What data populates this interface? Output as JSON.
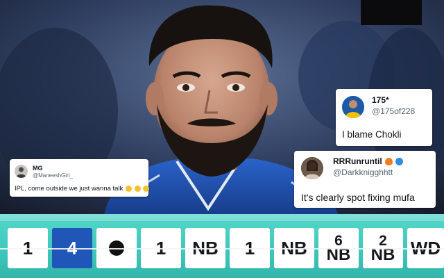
{
  "tweets": [
    {
      "name": "MG",
      "handle": "@ManeeshGiri_",
      "text": "IPL, come outside we just wanna talk",
      "emoji": [
        "loudly-crying-face-icon",
        "loudly-crying-face-icon",
        "loudly-crying-face-icon"
      ]
    },
    {
      "name": "175*",
      "handle": "@175of228",
      "text": "I blame Chokli"
    },
    {
      "name": "RRRunruntil",
      "name_emoji": [
        "fire-icon",
        "wave-icon"
      ],
      "handle": "@Darkknigghhtt",
      "text": "It's clearly spot fixing mufa"
    }
  ],
  "over_balls": [
    {
      "top": "1",
      "bottom": ""
    },
    {
      "top": "4",
      "bottom": "",
      "highlight": true
    },
    {
      "top": "",
      "bottom": "",
      "wicket": true
    },
    {
      "top": "1",
      "bottom": ""
    },
    {
      "top": "NB",
      "bottom": ""
    },
    {
      "top": "1",
      "bottom": ""
    },
    {
      "top": "NB",
      "bottom": ""
    },
    {
      "top": "6",
      "bottom": "NB"
    },
    {
      "top": "2",
      "bottom": "NB"
    },
    {
      "top": "WD",
      "bottom": ""
    }
  ],
  "colors": {
    "strip": "#3ec6bb",
    "highlight_ball": "#1f56b8",
    "jersey": "#1f4fb0"
  }
}
